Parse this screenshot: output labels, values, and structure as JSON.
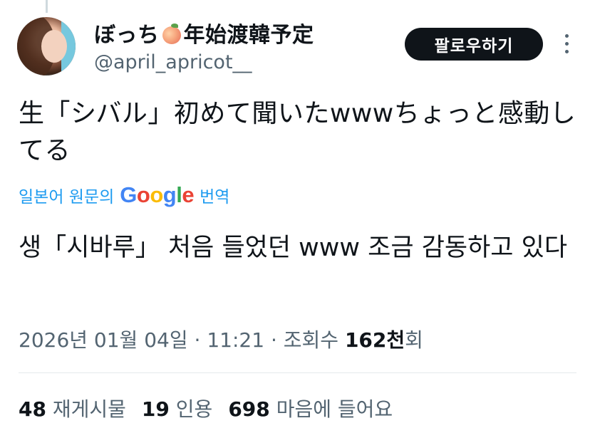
{
  "user": {
    "display_name_prefix": "ぼっち",
    "display_name_suffix": "年始渡韓予定",
    "handle": "@april_apricot__",
    "name_emoji": "peach-icon"
  },
  "follow_button": {
    "label": "팔로우하기"
  },
  "tweet": {
    "text": "生「シバル」初めて聞いたwwwちょっと感動してる"
  },
  "translation": {
    "label_prefix": "일본어 원문의",
    "google_letters": [
      "G",
      "o",
      "o",
      "g",
      "l",
      "e"
    ],
    "label_suffix": "번역",
    "text": "생「시바루」 처음 들었던 www 조금 감동하고 있다"
  },
  "meta": {
    "date": "2026년 01월 04일",
    "time": "11:21",
    "views_label": "조회수",
    "views_value": "162천",
    "views_suffix": "회",
    "separator": "·"
  },
  "stats": {
    "reposts_count": "48",
    "reposts_label": "재게시물",
    "quotes_count": "19",
    "quotes_label": "인용",
    "likes_count": "698",
    "likes_label": "마음에 들어요"
  },
  "colors": {
    "accent": "#1d9bf0",
    "text_primary": "#0f1419",
    "text_secondary": "#536471",
    "button_bg": "#0f1419"
  }
}
